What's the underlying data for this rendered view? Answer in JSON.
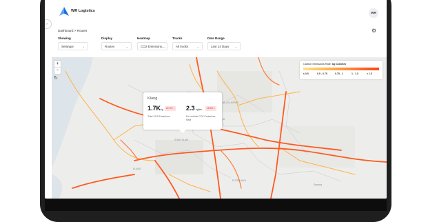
{
  "app": {
    "brand": "WR Logistics",
    "avatar": "WR"
  },
  "breadcrumb": "Dashboard > Routes",
  "filters": {
    "showing": {
      "label": "Showing",
      "value": "Selangor"
    },
    "display": {
      "label": "Display",
      "value": "Routes"
    },
    "heatmap": {
      "label": "Heatmap",
      "value": "CO2 Emissions ..."
    },
    "trucks": {
      "label": "Trucks",
      "value": "All trucks"
    },
    "date_range": {
      "label": "Date Range",
      "value": "Last 14 Days"
    }
  },
  "map_controls": {
    "zoom_in": "+",
    "zoom_out": "−",
    "reset": "↻"
  },
  "legend": {
    "title_prefix": "Carbon Emissions Rate:",
    "title_unit": "kg CO2/km",
    "ticks": [
      "≤ 0.5",
      "0.5 - 0.75",
      "0.75 - 1",
      "1 - 1.5",
      "≥ 1.5"
    ],
    "gradient_colors": [
      "#ffe08a",
      "#ffb347",
      "#ff8a3c",
      "#ff5a1f",
      "#ff4a14"
    ]
  },
  "popup": {
    "title": "Klang",
    "total_value": "1.7K",
    "total_unit": "kg",
    "total_change": "22.4% ↑",
    "total_desc": "Total CO2 Emissions",
    "rate_value": "2.3",
    "rate_unit": "kg/km",
    "rate_change": "16.5% ↑",
    "rate_desc": "Per vehicle CO2 Emissions Rate"
  },
  "map_labels": [
    {
      "name": "KUALA LUMPUR"
    },
    {
      "name": "PETALING JAYA"
    },
    {
      "name": "SHAH ALAM"
    },
    {
      "name": "PUTRAJAYA"
    },
    {
      "name": "KLANG"
    },
    {
      "name": "Sepang"
    }
  ],
  "colors": {
    "accent": "#1e6fd9",
    "route_hot": "#ff5a1f",
    "route_warm": "#ffb347",
    "map_bg": "#ededeb",
    "water": "#dde5ea"
  }
}
